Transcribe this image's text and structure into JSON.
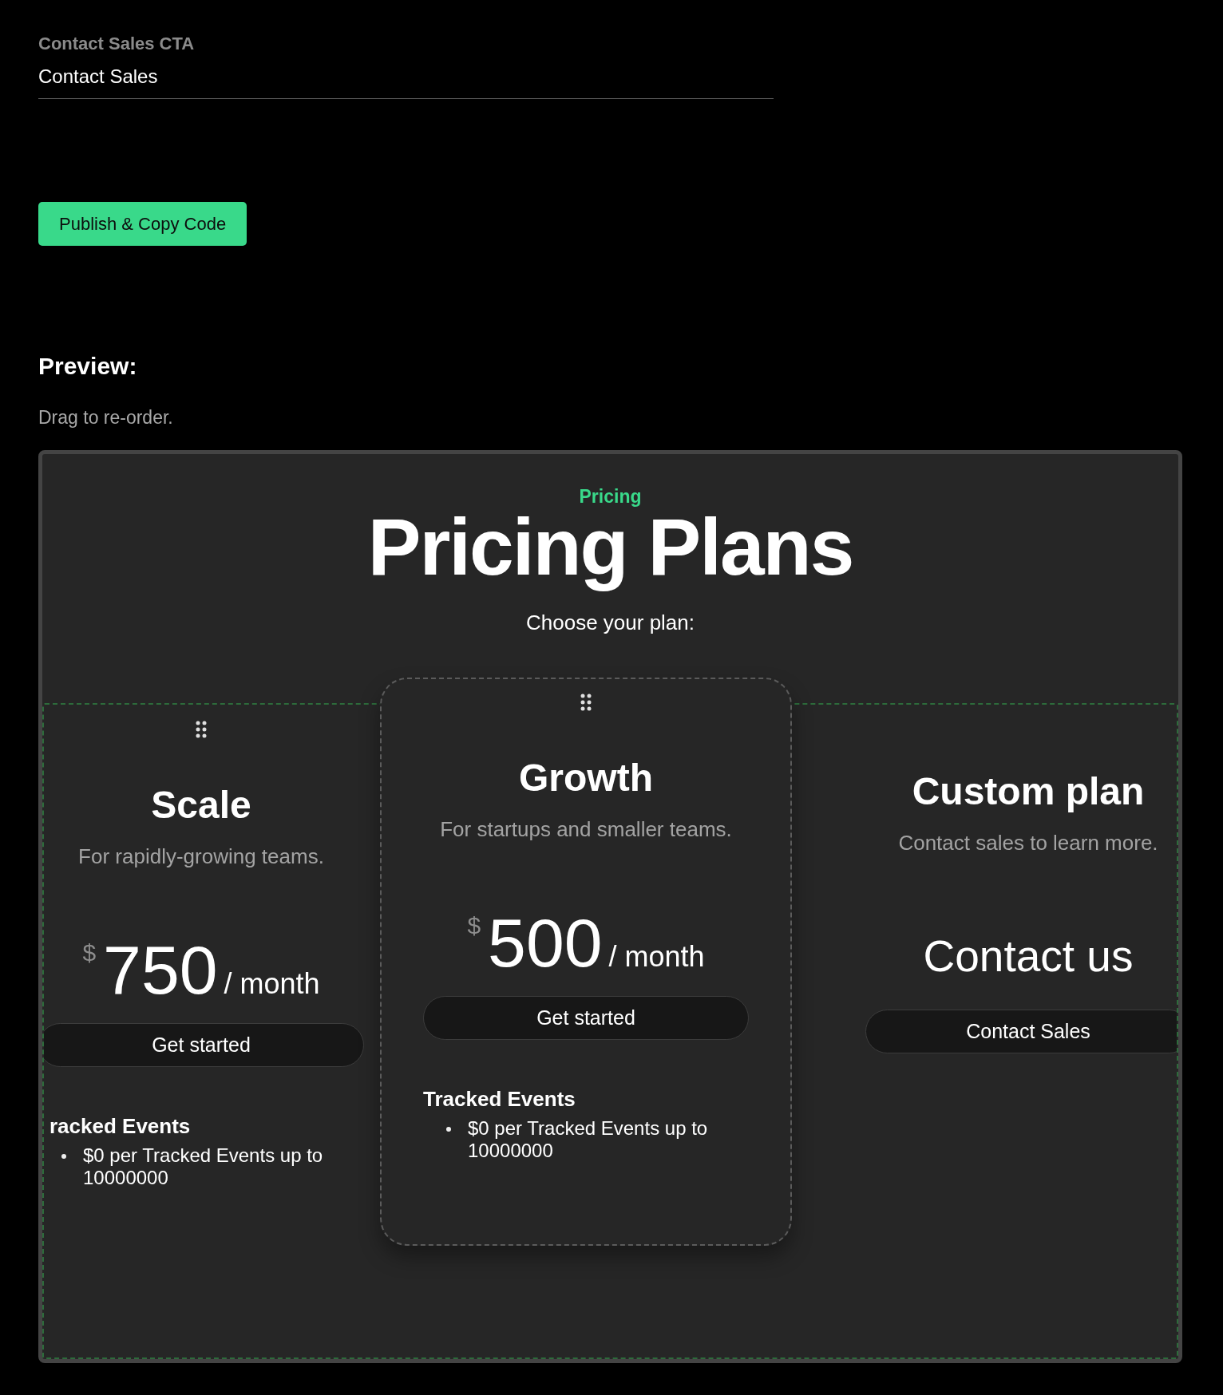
{
  "cta_setting": {
    "label": "Contact Sales CTA",
    "value": "Contact Sales"
  },
  "publish_button": "Publish & Copy Code",
  "preview": {
    "heading": "Preview:",
    "hint": "Drag to re-order.",
    "page": {
      "eyebrow": "Pricing",
      "title": "Pricing Plans",
      "subtitle": "Choose your plan:",
      "plans": [
        {
          "kind": "priced",
          "dragging": false,
          "name": "Scale",
          "description": "For rapidly-growing teams.",
          "currency": "$",
          "amount": "750",
          "period": "/ month",
          "button": "Get started",
          "features": [
            {
              "heading": "racked Events",
              "items": [
                "$0 per Tracked Events up to 10000000"
              ]
            }
          ]
        },
        {
          "kind": "priced",
          "dragging": true,
          "name": "Growth",
          "description": "For startups and smaller teams.",
          "currency": "$",
          "amount": "500",
          "period": "/ month",
          "button": "Get started",
          "features": [
            {
              "heading": "Tracked Events",
              "items": [
                "$0 per Tracked Events up to 10000000"
              ]
            }
          ]
        },
        {
          "kind": "contact",
          "dragging": false,
          "name": "Custom plan",
          "description": "Contact sales to learn more.",
          "price_text": "Contact us",
          "button": "Contact Sales"
        }
      ]
    }
  }
}
